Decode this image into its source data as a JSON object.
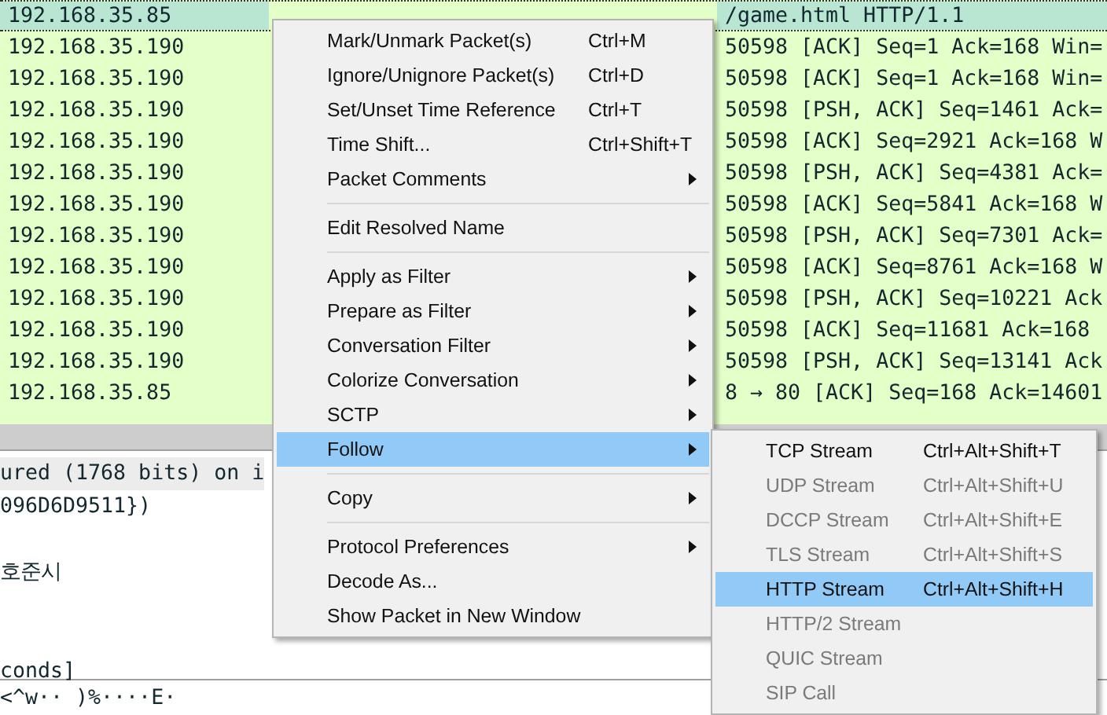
{
  "packet_list": {
    "rows": [
      {
        "source": "192.168.35.85",
        "info": "/game.html HTTP/1.1",
        "selected": true
      },
      {
        "source": "192.168.35.190",
        "info": "50598 [ACK] Seq=1 Ack=168 Win=",
        "selected": false
      },
      {
        "source": "192.168.35.190",
        "info": "50598 [ACK] Seq=1 Ack=168 Win=",
        "selected": false
      },
      {
        "source": "192.168.35.190",
        "info": "50598 [PSH, ACK] Seq=1461 Ack=",
        "selected": false
      },
      {
        "source": "192.168.35.190",
        "info": "50598 [ACK] Seq=2921 Ack=168 W",
        "selected": false
      },
      {
        "source": "192.168.35.190",
        "info": "50598 [PSH, ACK] Seq=4381 Ack=",
        "selected": false
      },
      {
        "source": "192.168.35.190",
        "info": "50598 [ACK] Seq=5841 Ack=168 W",
        "selected": false
      },
      {
        "source": "192.168.35.190",
        "info": "50598 [PSH, ACK] Seq=7301 Ack=",
        "selected": false
      },
      {
        "source": "192.168.35.190",
        "info": "50598 [ACK] Seq=8761 Ack=168 W",
        "selected": false
      },
      {
        "source": "192.168.35.190",
        "info": "50598 [PSH, ACK] Seq=10221 Ack",
        "selected": false
      },
      {
        "source": "192.168.35.190",
        "info": "50598 [ACK] Seq=11681 Ack=168",
        "selected": false
      },
      {
        "source": "192.168.35.190",
        "info": "50598 [PSH, ACK] Seq=13141 Ack",
        "selected": false
      },
      {
        "source": "192.168.35.85",
        "info": "8 → 80 [ACK] Seq=168 Ack=14601",
        "selected": false
      }
    ]
  },
  "packet_details": {
    "lines": [
      {
        "text": "ured (1768 bits) on i",
        "selected": true
      },
      {
        "text": "096D6D9511})",
        "selected": false
      },
      {
        "text": "호준시",
        "selected": false
      },
      {
        "text": "conds]",
        "selected": false
      }
    ]
  },
  "packet_bytes": {
    "text": "<^w·· )%····E·"
  },
  "context_menu": {
    "items": [
      {
        "kind": "item",
        "label": "Mark/Unmark Packet(s)",
        "shortcut": "Ctrl+M",
        "submenu": false,
        "selected": false
      },
      {
        "kind": "item",
        "label": "Ignore/Unignore Packet(s)",
        "shortcut": "Ctrl+D",
        "submenu": false,
        "selected": false
      },
      {
        "kind": "item",
        "label": "Set/Unset Time Reference",
        "shortcut": "Ctrl+T",
        "submenu": false,
        "selected": false
      },
      {
        "kind": "item",
        "label": "Time Shift...",
        "shortcut": "Ctrl+Shift+T",
        "submenu": false,
        "selected": false
      },
      {
        "kind": "item",
        "label": "Packet Comments",
        "submenu": true,
        "selected": false
      },
      {
        "kind": "separator"
      },
      {
        "kind": "item",
        "label": "Edit Resolved Name",
        "submenu": false,
        "selected": false
      },
      {
        "kind": "separator"
      },
      {
        "kind": "item",
        "label": "Apply as Filter",
        "submenu": true,
        "selected": false
      },
      {
        "kind": "item",
        "label": "Prepare as Filter",
        "submenu": true,
        "selected": false
      },
      {
        "kind": "item",
        "label": "Conversation Filter",
        "submenu": true,
        "selected": false
      },
      {
        "kind": "item",
        "label": "Colorize Conversation",
        "submenu": true,
        "selected": false
      },
      {
        "kind": "item",
        "label": "SCTP",
        "submenu": true,
        "selected": false
      },
      {
        "kind": "item",
        "label": "Follow",
        "submenu": true,
        "selected": true
      },
      {
        "kind": "separator"
      },
      {
        "kind": "item",
        "label": "Copy",
        "submenu": true,
        "selected": false
      },
      {
        "kind": "separator"
      },
      {
        "kind": "item",
        "label": "Protocol Preferences",
        "submenu": true,
        "selected": false
      },
      {
        "kind": "item",
        "label": "Decode As...",
        "submenu": false,
        "selected": false
      },
      {
        "kind": "item",
        "label": "Show Packet in New Window",
        "submenu": false,
        "selected": false
      }
    ]
  },
  "follow_submenu": {
    "items": [
      {
        "label": "TCP Stream",
        "shortcut": "Ctrl+Alt+Shift+T",
        "disabled": false,
        "selected": false
      },
      {
        "label": "UDP Stream",
        "shortcut": "Ctrl+Alt+Shift+U",
        "disabled": true,
        "selected": false
      },
      {
        "label": "DCCP Stream",
        "shortcut": "Ctrl+Alt+Shift+E",
        "disabled": true,
        "selected": false
      },
      {
        "label": "TLS Stream",
        "shortcut": "Ctrl+Alt+Shift+S",
        "disabled": true,
        "selected": false
      },
      {
        "label": "HTTP Stream",
        "shortcut": "Ctrl+Alt+Shift+H",
        "disabled": false,
        "selected": true
      },
      {
        "label": "HTTP/2 Stream",
        "disabled": true,
        "selected": false
      },
      {
        "label": "QUIC Stream",
        "disabled": true,
        "selected": false
      },
      {
        "label": "SIP Call",
        "disabled": true,
        "selected": false
      }
    ]
  }
}
